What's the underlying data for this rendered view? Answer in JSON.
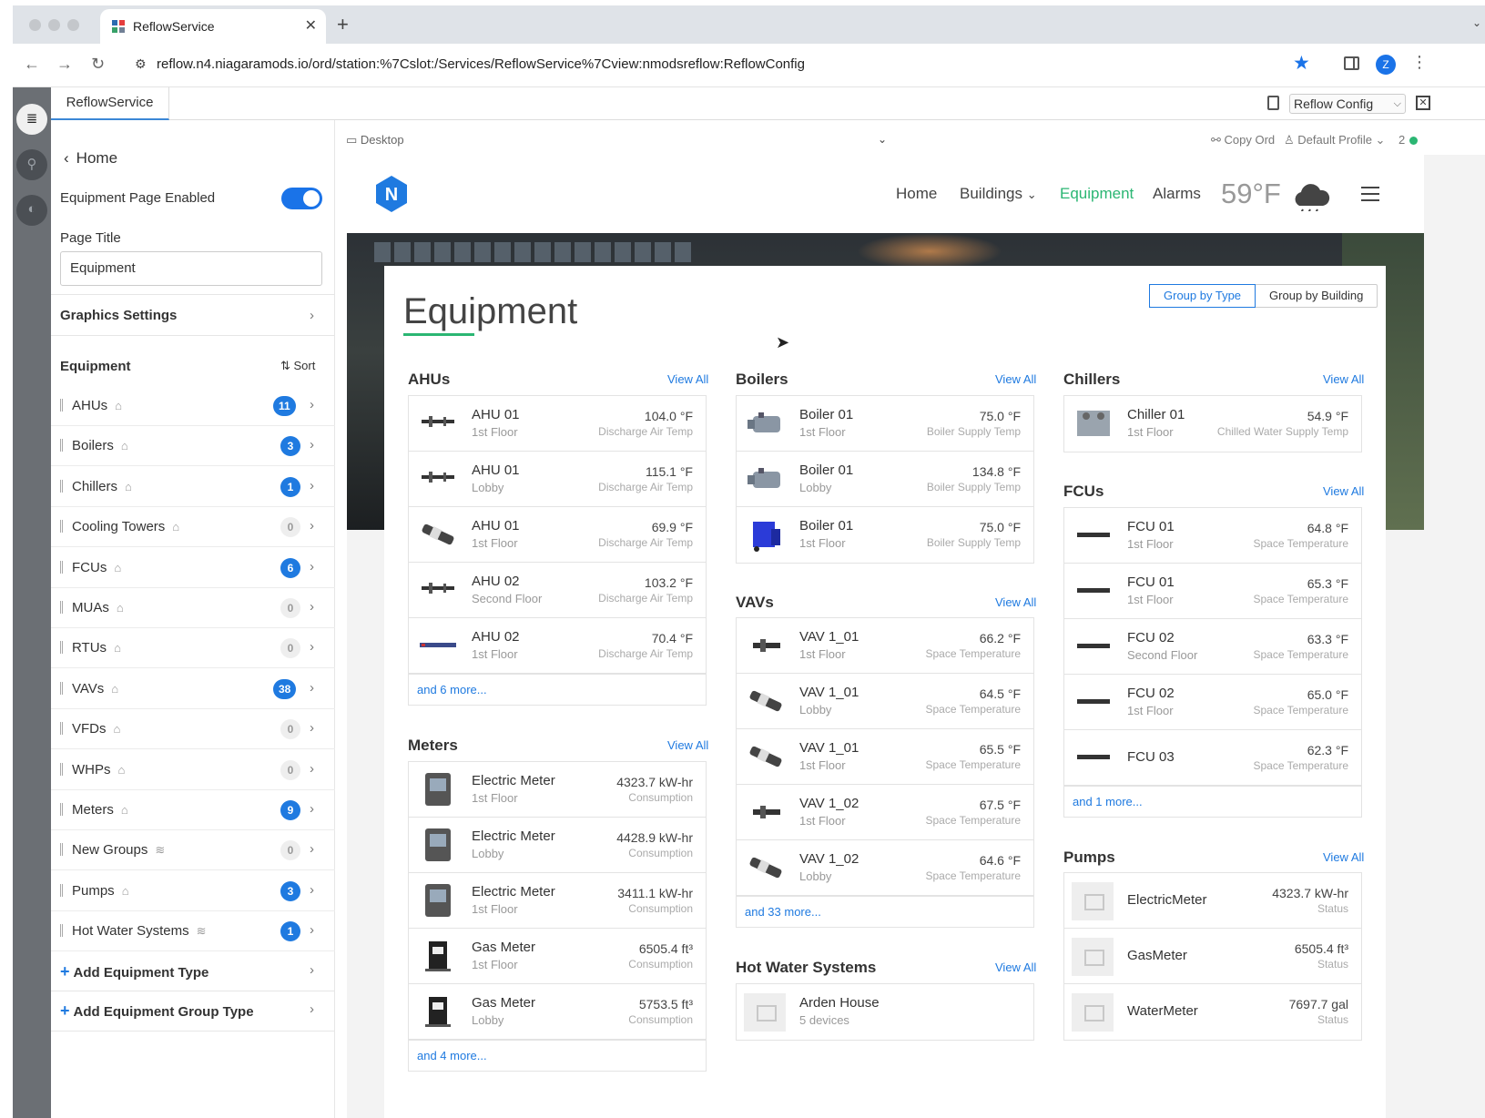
{
  "browser": {
    "tab_title": "ReflowService",
    "url": "reflow.n4.niagaramods.io/ord/station:%7Cslot:/Services/ReflowService%7Cview:nmodsreflow:ReflowConfig",
    "avatar_letter": "Z"
  },
  "workbench": {
    "tab": "ReflowService",
    "view_selector": "Reflow Config"
  },
  "sidebar": {
    "home": "Home",
    "page_enabled_label": "Equipment Page Enabled",
    "page_title_label": "Page Title",
    "page_title_value": "Equipment",
    "graphics_settings": "Graphics Settings",
    "equipment_header": "Equipment",
    "sort_label": "Sort",
    "items": [
      {
        "label": "AHUs",
        "count": "11",
        "active": true,
        "icon": "building-icon"
      },
      {
        "label": "Boilers",
        "count": "3",
        "active": true,
        "icon": "building-icon"
      },
      {
        "label": "Chillers",
        "count": "1",
        "active": true,
        "icon": "building-icon"
      },
      {
        "label": "Cooling Towers",
        "count": "0",
        "active": false,
        "icon": "building-icon"
      },
      {
        "label": "FCUs",
        "count": "6",
        "active": true,
        "icon": "building-icon"
      },
      {
        "label": "MUAs",
        "count": "0",
        "active": false,
        "icon": "building-icon"
      },
      {
        "label": "RTUs",
        "count": "0",
        "active": false,
        "icon": "building-icon"
      },
      {
        "label": "VAVs",
        "count": "38",
        "active": true,
        "icon": "building-icon"
      },
      {
        "label": "VFDs",
        "count": "0",
        "active": false,
        "icon": "building-icon"
      },
      {
        "label": "WHPs",
        "count": "0",
        "active": false,
        "icon": "building-icon"
      },
      {
        "label": "Meters",
        "count": "9",
        "active": true,
        "icon": "building-icon"
      },
      {
        "label": "New Groups",
        "count": "0",
        "active": false,
        "icon": "layers-icon"
      },
      {
        "label": "Pumps",
        "count": "3",
        "active": true,
        "icon": "building-icon"
      },
      {
        "label": "Hot Water Systems",
        "count": "1",
        "active": true,
        "icon": "layers-icon"
      }
    ],
    "add_type": "Add Equipment Type",
    "add_group_type": "Add Equipment Group Type"
  },
  "preview_bar": {
    "device": "Desktop",
    "copy_ord": "Copy Ord",
    "profile": "Default Profile",
    "status_count": "2"
  },
  "app": {
    "nav": {
      "home": "Home",
      "buildings": "Buildings",
      "equipment": "Equipment",
      "alarms": "Alarms"
    },
    "temperature": "59°F",
    "page_title": "Equipment",
    "group_by_type": "Group by Type",
    "group_by_building": "Group by Building",
    "view_all": "View All",
    "ahus": {
      "title": "AHUs",
      "items": [
        {
          "name": "AHU 01",
          "loc": "1st Floor",
          "value": "104.0 °F",
          "label": "Discharge Air Temp"
        },
        {
          "name": "AHU 01",
          "loc": "Lobby",
          "value": "115.1 °F",
          "label": "Discharge Air Temp"
        },
        {
          "name": "AHU 01",
          "loc": "1st Floor",
          "value": "69.9 °F",
          "label": "Discharge Air Temp"
        },
        {
          "name": "AHU 02",
          "loc": "Second Floor",
          "value": "103.2 °F",
          "label": "Discharge Air Temp"
        },
        {
          "name": "AHU 02",
          "loc": "1st Floor",
          "value": "70.4 °F",
          "label": "Discharge Air Temp"
        }
      ],
      "more": "and 6 more..."
    },
    "meters": {
      "title": "Meters",
      "items": [
        {
          "name": "Electric Meter",
          "loc": "1st Floor",
          "value": "4323.7 kW-hr",
          "label": "Consumption"
        },
        {
          "name": "Electric Meter",
          "loc": "Lobby",
          "value": "4428.9 kW-hr",
          "label": "Consumption"
        },
        {
          "name": "Electric Meter",
          "loc": "1st Floor",
          "value": "3411.1 kW-hr",
          "label": "Consumption"
        },
        {
          "name": "Gas Meter",
          "loc": "1st Floor",
          "value": "6505.4 ft³",
          "label": "Consumption"
        },
        {
          "name": "Gas Meter",
          "loc": "Lobby",
          "value": "5753.5 ft³",
          "label": "Consumption"
        }
      ],
      "more": "and 4 more..."
    },
    "boilers": {
      "title": "Boilers",
      "items": [
        {
          "name": "Boiler 01",
          "loc": "1st Floor",
          "value": "75.0 °F",
          "label": "Boiler Supply Temp"
        },
        {
          "name": "Boiler 01",
          "loc": "Lobby",
          "value": "134.8 °F",
          "label": "Boiler Supply Temp"
        },
        {
          "name": "Boiler 01",
          "loc": "1st Floor",
          "value": "75.0 °F",
          "label": "Boiler Supply Temp"
        }
      ]
    },
    "vavs": {
      "title": "VAVs",
      "items": [
        {
          "name": "VAV 1_01",
          "loc": "1st Floor",
          "value": "66.2 °F",
          "label": "Space Temperature"
        },
        {
          "name": "VAV 1_01",
          "loc": "Lobby",
          "value": "64.5 °F",
          "label": "Space Temperature"
        },
        {
          "name": "VAV 1_01",
          "loc": "1st Floor",
          "value": "65.5 °F",
          "label": "Space Temperature"
        },
        {
          "name": "VAV 1_02",
          "loc": "1st Floor",
          "value": "67.5 °F",
          "label": "Space Temperature"
        },
        {
          "name": "VAV 1_02",
          "loc": "Lobby",
          "value": "64.6 °F",
          "label": "Space Temperature"
        }
      ],
      "more": "and 33 more..."
    },
    "hot_water": {
      "title": "Hot Water Systems",
      "items": [
        {
          "name": "Arden House",
          "loc": "5 devices"
        }
      ]
    },
    "chillers": {
      "title": "Chillers",
      "items": [
        {
          "name": "Chiller 01",
          "loc": "1st Floor",
          "value": "54.9 °F",
          "label": "Chilled Water Supply Temp"
        }
      ]
    },
    "fcus": {
      "title": "FCUs",
      "items": [
        {
          "name": "FCU 01",
          "loc": "1st Floor",
          "value": "64.8 °F",
          "label": "Space Temperature"
        },
        {
          "name": "FCU 01",
          "loc": "1st Floor",
          "value": "65.3 °F",
          "label": "Space Temperature"
        },
        {
          "name": "FCU 02",
          "loc": "Second Floor",
          "value": "63.3 °F",
          "label": "Space Temperature"
        },
        {
          "name": "FCU 02",
          "loc": "1st Floor",
          "value": "65.0 °F",
          "label": "Space Temperature"
        },
        {
          "name": "FCU 03",
          "loc": "",
          "value": "62.3 °F",
          "label": "Space Temperature"
        }
      ],
      "more": "and 1 more..."
    },
    "pumps": {
      "title": "Pumps",
      "items": [
        {
          "name": "ElectricMeter",
          "value": "4323.7 kW-hr",
          "label": "Status"
        },
        {
          "name": "GasMeter",
          "value": "6505.4 ft³",
          "label": "Status"
        },
        {
          "name": "WaterMeter",
          "value": "7697.7 gal",
          "label": "Status"
        }
      ]
    }
  },
  "colors": {
    "accent_green": "#2bb673",
    "accent_blue": "#1f7ae0"
  }
}
